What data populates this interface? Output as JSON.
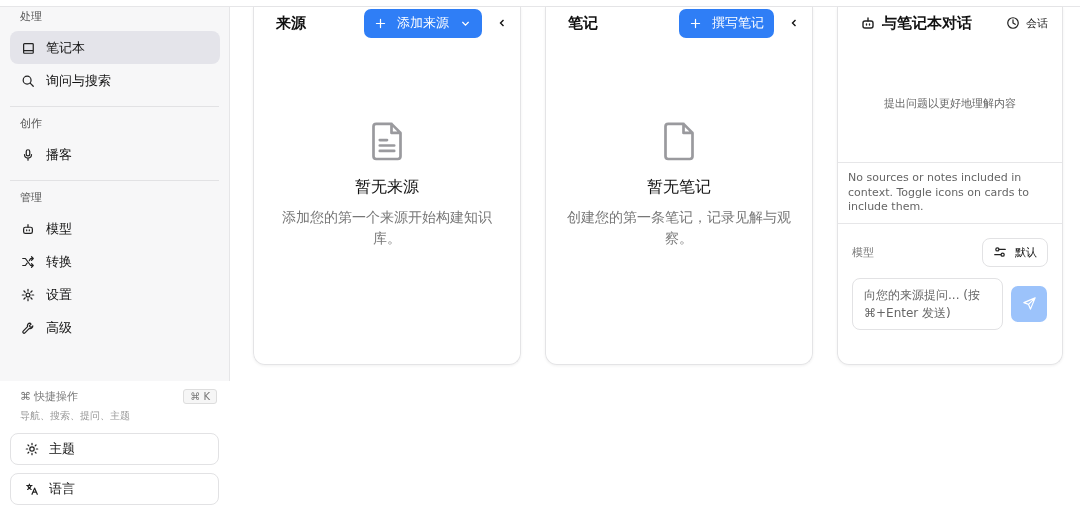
{
  "sidebar": {
    "sections": [
      {
        "heading": "处理",
        "items": [
          {
            "label": "笔记本",
            "selected": true
          },
          {
            "label": "询问与搜索",
            "selected": false
          }
        ]
      },
      {
        "heading": "创作",
        "items": [
          {
            "label": "播客",
            "selected": false
          }
        ]
      },
      {
        "heading": "管理",
        "items": [
          {
            "label": "模型",
            "selected": false
          },
          {
            "label": "转换",
            "selected": false
          },
          {
            "label": "设置",
            "selected": false
          },
          {
            "label": "高级",
            "selected": false
          }
        ]
      }
    ],
    "quick_actions": {
      "label": "快捷操作",
      "shortcut": "⌘ K",
      "hint": "导航、搜索、提问、主题",
      "symbol": "⌘"
    },
    "buttons": [
      {
        "label": "主题"
      },
      {
        "label": "语言"
      }
    ]
  },
  "sources": {
    "title": "来源",
    "add_button": "添加来源",
    "empty_title": "暂无来源",
    "empty_text": "添加您的第一个来源开始构建知识库。"
  },
  "notes": {
    "title": "笔记",
    "add_button": "撰写笔记",
    "empty_title": "暂无笔记",
    "empty_text": "创建您的第一条笔记，记录见解与观察。"
  },
  "chat": {
    "title": "与笔记本对话",
    "sessions_button": "会话",
    "hint": "提出问题以更好地理解内容",
    "context_note": "No sources or notes included in context. Toggle icons on cards to include them.",
    "model_label": "模型",
    "model_button": "默认",
    "input_placeholder": "向您的来源提问... (按 ⌘+Enter 发送)",
    "send_disabled": true
  }
}
